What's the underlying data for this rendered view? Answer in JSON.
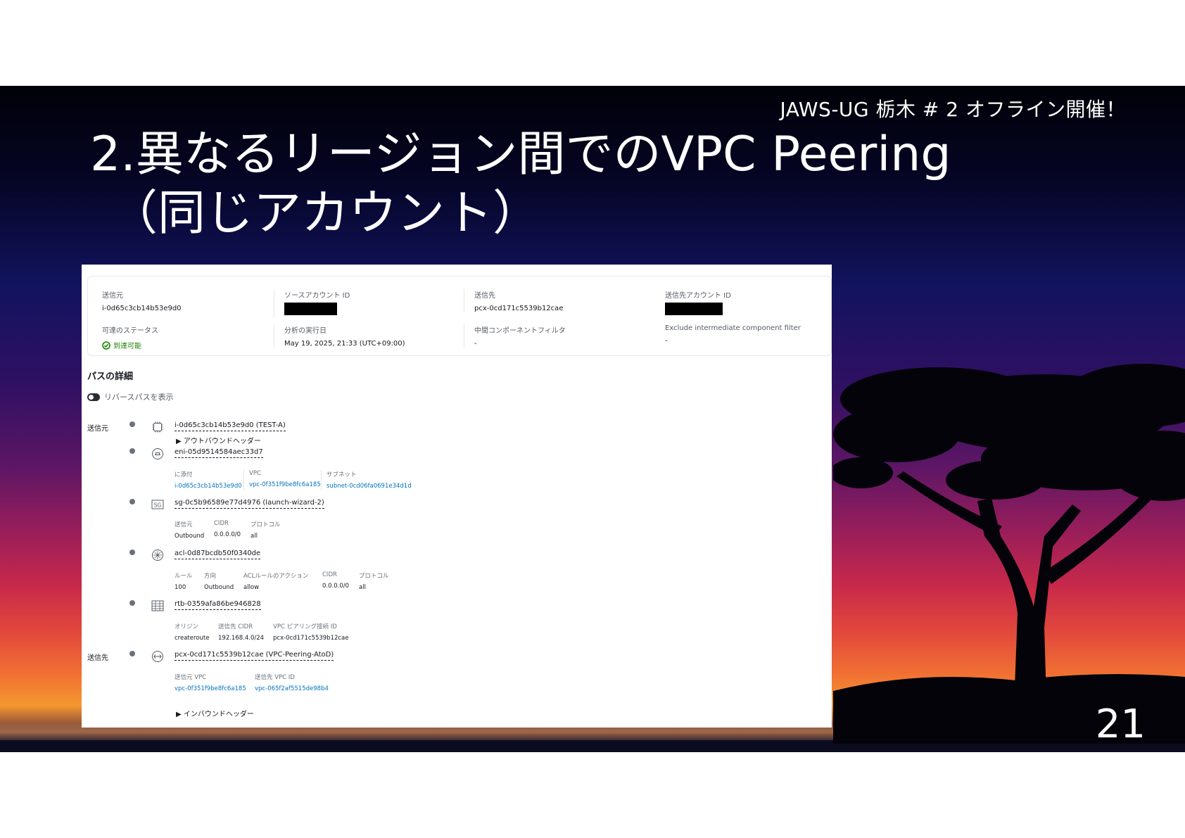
{
  "slide": {
    "event": "JAWS-UG 栃木 # 2 オフライン開催！",
    "title_line1": "2.異なるリージョン間でのVPC Peering",
    "title_line2": "（同じアカウント）",
    "page_number": "21"
  },
  "summary": {
    "source_label": "送信元",
    "source_value": "i-0d65c3cb14b53e9d0",
    "source_account_label": "ソースアカウント ID",
    "destination_label": "送信先",
    "destination_value": "pcx-0cd171c5539b12cae",
    "destination_account_label": "送信先アカウント ID",
    "reachability_label": "可達のステータス",
    "reachability_value": "到達可能",
    "run_time_label": "分析の実行日",
    "run_time_value": "May 19, 2025, 21:33 (UTC+09:00)",
    "intermediate_label": "中間コンポーネントフィルタ",
    "intermediate_value": "-",
    "exclude_label": "Exclude intermediate component filter",
    "exclude_value": "-"
  },
  "path": {
    "title": "パスの詳細",
    "reverse_toggle_label": "リバースパスを表示",
    "source_side_label": "送信元",
    "destination_side_label": "送信先",
    "instance": {
      "link": "i-0d65c3cb14b53e9d0 (TEST-A)",
      "expander": "アウトバウンドヘッダー"
    },
    "eni": {
      "link": "eni-05d9514584aec33d7",
      "h1": "に添付",
      "v1": "i-0d65c3cb14b53e9d0",
      "h2": "VPC",
      "v2": "vpc-0f351f9be8fc6a185",
      "h3": "サブネット",
      "v3": "subnet-0cd06fa0691e34d1d"
    },
    "sg": {
      "link": "sg-0c5b96589e77d4976 (launch-wizard-2)",
      "h1": "送信元",
      "v1": "Outbound",
      "h2": "CIDR",
      "v2": "0.0.0.0/0",
      "h3": "プロトコル",
      "v3": "all"
    },
    "acl": {
      "link": "acl-0d87bcdb50f0340de",
      "h1": "ルール",
      "v1": "100",
      "h2": "方向",
      "v2": "Outbound",
      "h3": "ACLルールのアクション",
      "v3": "allow",
      "h4": "CIDR",
      "v4": "0.0.0.0/0",
      "h5": "プロトコル",
      "v5": "all"
    },
    "rtb": {
      "link": "rtb-0359afa86be946828",
      "h1": "オリジン",
      "v1": "createroute",
      "h2": "送信先 CIDR",
      "v2": "192.168.4.0/24",
      "h3": "VPC ピアリング接続 ID",
      "v3": "pcx-0cd171c5539b12cae"
    },
    "pcx": {
      "link": "pcx-0cd171c5539b12cae (VPC-Peering-AtoD)",
      "h1": "送信元 VPC",
      "v1": "vpc-0f351f9be8fc6a185",
      "h2": "送信先 VPC ID",
      "v2": "vpc-065f2af5515de98b4",
      "expander": "インバウンドヘッダー"
    }
  },
  "icons": {
    "instance": "chip-icon",
    "eni": "network-interface-icon",
    "sg": "security-group-icon",
    "acl": "network-acl-icon",
    "rtb": "route-table-icon",
    "pcx": "peering-connection-icon",
    "status": "check-circle-icon"
  },
  "colors": {
    "link": "#0073bb",
    "success": "#1d8102"
  }
}
